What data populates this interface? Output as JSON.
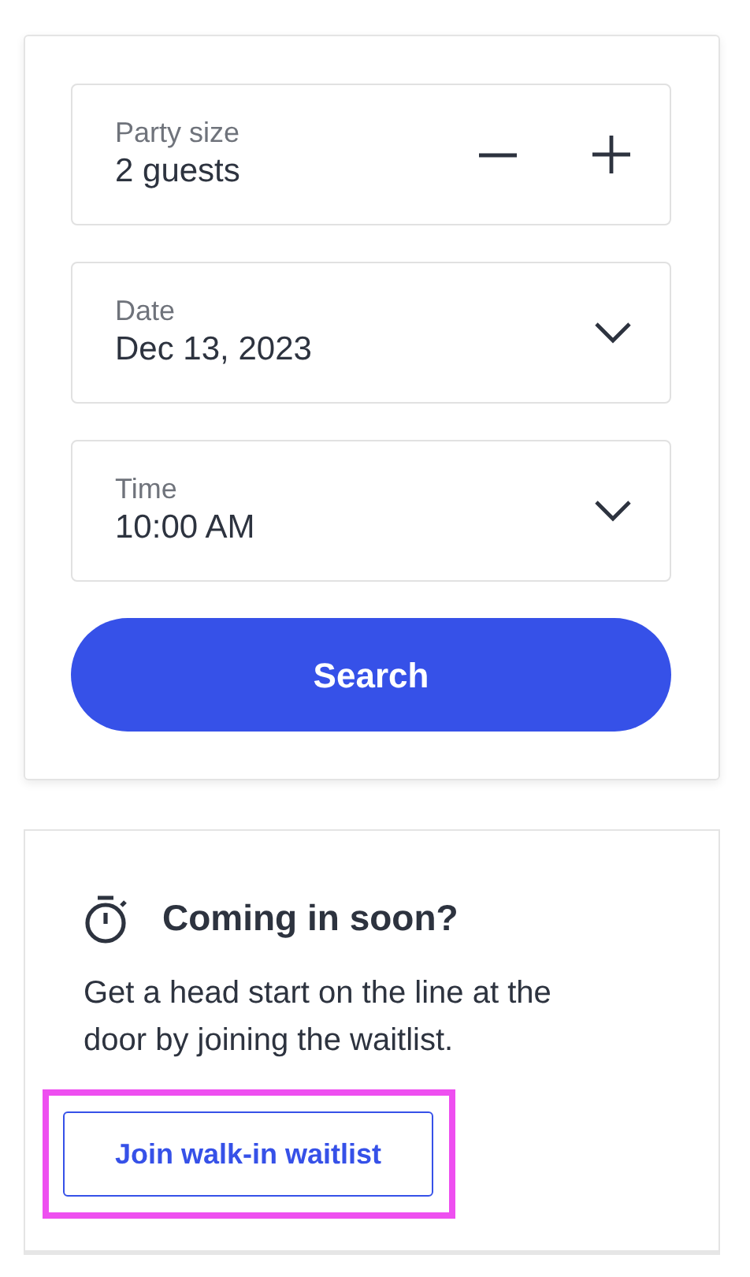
{
  "reservation_form": {
    "fields": [
      {
        "kind": "stepper",
        "label": "Party size",
        "value": "2 guests"
      },
      {
        "kind": "select",
        "label": "Date",
        "value": "Dec 13, 2023"
      },
      {
        "kind": "select",
        "label": "Time",
        "value": "10:00 AM"
      }
    ],
    "search_button": "Search"
  },
  "waitlist_card": {
    "title": "Coming in soon?",
    "text": "Get a head start on the line at the door by joining the waitlist.",
    "button": {
      "label": "Join walk-in waitlist",
      "highlighted": true
    }
  }
}
